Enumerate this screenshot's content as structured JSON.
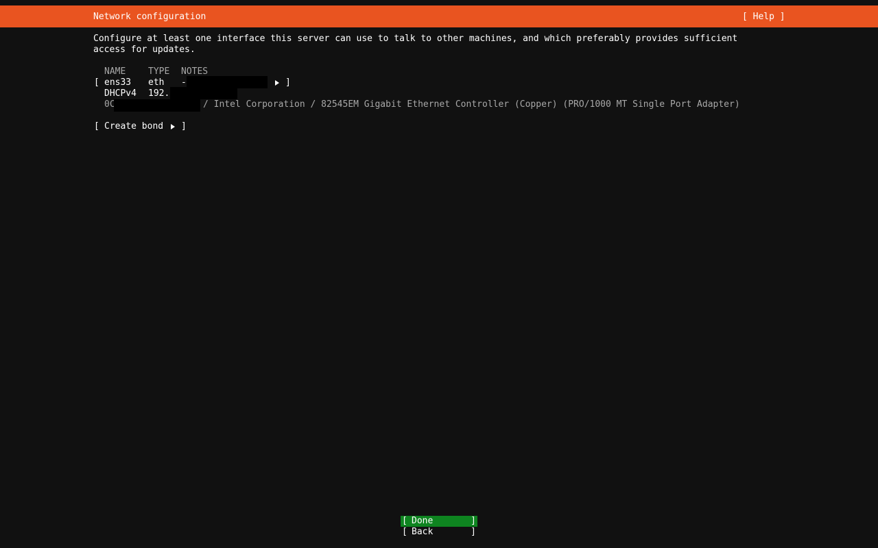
{
  "header": {
    "title": "Network configuration",
    "help_label": "[ Help ]"
  },
  "intro": {
    "line1": "Configure at least one interface this server can use to talk to other machines, and which preferably provides sufficient",
    "line2": "access for updates."
  },
  "table": {
    "headers": {
      "name": "NAME",
      "type": "TYPE",
      "notes": "NOTES"
    },
    "interface": {
      "name": "ens33",
      "type": "eth",
      "notes": "-",
      "addr_method": "DHCPv4",
      "addr_value": "192.",
      "mac_prefix": "0C",
      "vendor": "/ Intel Corporation / 82545EM Gigabit Ethernet Controller (Copper) (PRO/1000 MT Single Port Adapter)"
    }
  },
  "bracket_open": "[",
  "bracket_close": "]",
  "create_bond_label": "Create bond",
  "buttons": {
    "done_label": "Done",
    "back_label": "Back"
  },
  "colors": {
    "header_bg": "#e95420",
    "selected_bg": "#0e8420",
    "background": "#111111"
  }
}
